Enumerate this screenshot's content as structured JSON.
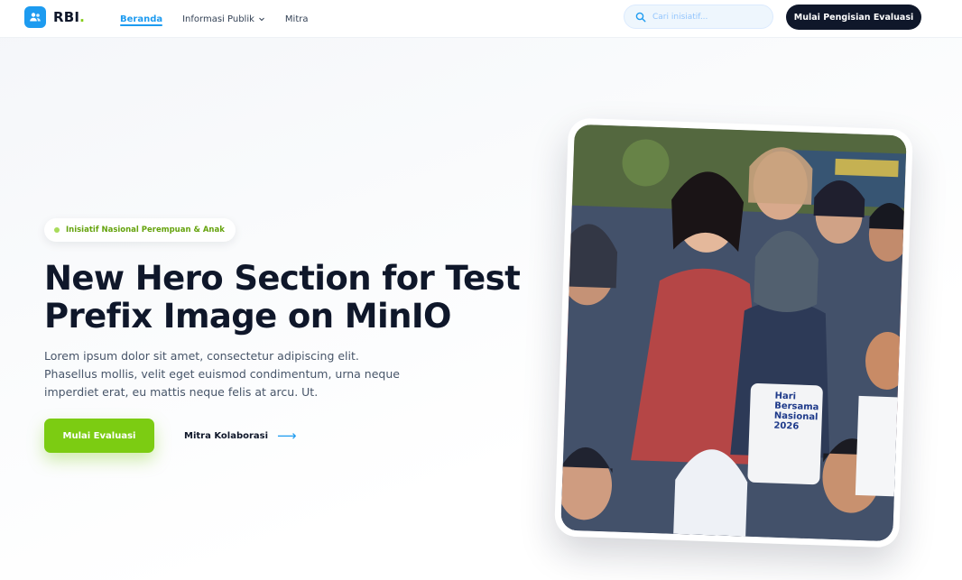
{
  "nav": {
    "logo_text": "RBI",
    "logo_dot": ".",
    "links": [
      {
        "label": "Beranda",
        "active": true
      },
      {
        "label": "Informasi Publik",
        "has_dropdown": true
      },
      {
        "label": "Mitra"
      }
    ],
    "search_placeholder": "Cari inisiatif...",
    "cta_label": "Mulai Pengisian Evaluasi"
  },
  "hero": {
    "tag": "Inisiatif Nasional Perempuan & Anak",
    "headline_line1": "New Hero Section for Test",
    "headline_line2": "Prefix Image on MinIO",
    "description": "Lorem ipsum dolor sit amet, consectetur adipiscing elit. Phasellus mollis, velit eget euismod condimentum, urna neque imperdiet erat, eu mattis neque felis at arcu. Ut.",
    "primary_button": "Mulai Evaluasi",
    "secondary_link": "Mitra Kolaborasi",
    "secondary_arrow": "⟶",
    "photo_shirt_text": [
      "Hari",
      "Bersama",
      "Nasional",
      "2026"
    ]
  },
  "colors": {
    "brand_blue": "#1d9bf0",
    "accent_green": "#7ccc12",
    "dark": "#0f172a"
  },
  "icons": {
    "logo": "users-icon",
    "search": "search-icon",
    "dropdown": "chevron-down-icon",
    "arrow": "arrow-right-icon"
  }
}
